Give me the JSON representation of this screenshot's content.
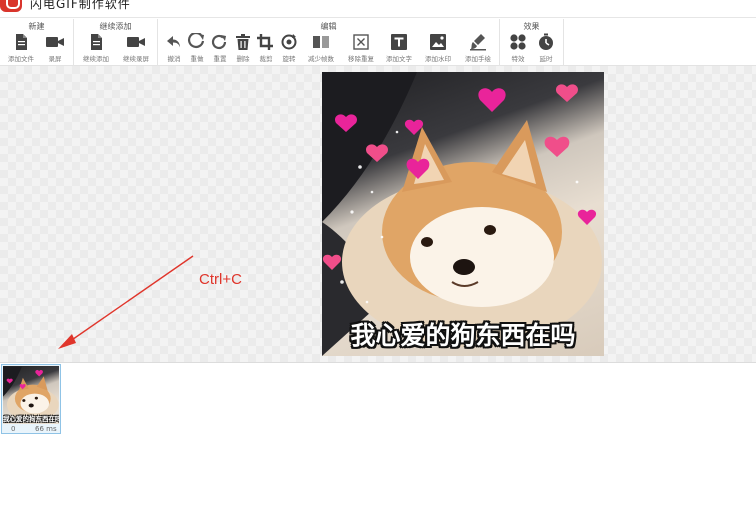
{
  "app": {
    "title": "闪电GIF制作软件"
  },
  "toolbar": {
    "groups": [
      {
        "title": "新建",
        "tools": [
          {
            "label": "添加文件",
            "icon": "file-icon"
          },
          {
            "label": "录屏",
            "icon": "video-camera-icon"
          }
        ]
      },
      {
        "title": "继续添加",
        "tools": [
          {
            "label": "继续添加",
            "icon": "file-add-icon"
          },
          {
            "label": "继续录屏",
            "icon": "video-camera-icon"
          }
        ]
      },
      {
        "title": "编辑",
        "tools": [
          {
            "label": "撤消",
            "icon": "undo-icon"
          },
          {
            "label": "重做",
            "icon": "redo-icon"
          },
          {
            "label": "重置",
            "icon": "reset-icon"
          },
          {
            "label": "删除",
            "icon": "trash-icon"
          },
          {
            "label": "裁剪",
            "icon": "crop-icon"
          },
          {
            "label": "旋转",
            "icon": "rotate-icon"
          },
          {
            "label": "减少帧数",
            "icon": "reduce-frames-icon"
          },
          {
            "label": "移除重复",
            "icon": "remove-duplicate-icon"
          },
          {
            "label": "添加文字",
            "icon": "text-icon"
          },
          {
            "label": "添加水印",
            "icon": "watermark-icon"
          },
          {
            "label": "添加手绘",
            "icon": "brush-icon"
          }
        ]
      },
      {
        "title": "效果",
        "tools": [
          {
            "label": "特效",
            "icon": "effects-icon"
          },
          {
            "label": "延时",
            "icon": "timer-icon"
          }
        ]
      }
    ]
  },
  "canvas": {
    "caption": "我心爱的狗东西在吗",
    "annotation": "Ctrl+C",
    "annotation_color": "#e0352b"
  },
  "filmstrip": {
    "frames": [
      {
        "index": "0",
        "delay": "66 ms",
        "caption": "我心爱的狗东西在吗"
      }
    ]
  },
  "colors": {
    "accent": "#d9352c",
    "thumb_border": "#8fc3e6"
  }
}
